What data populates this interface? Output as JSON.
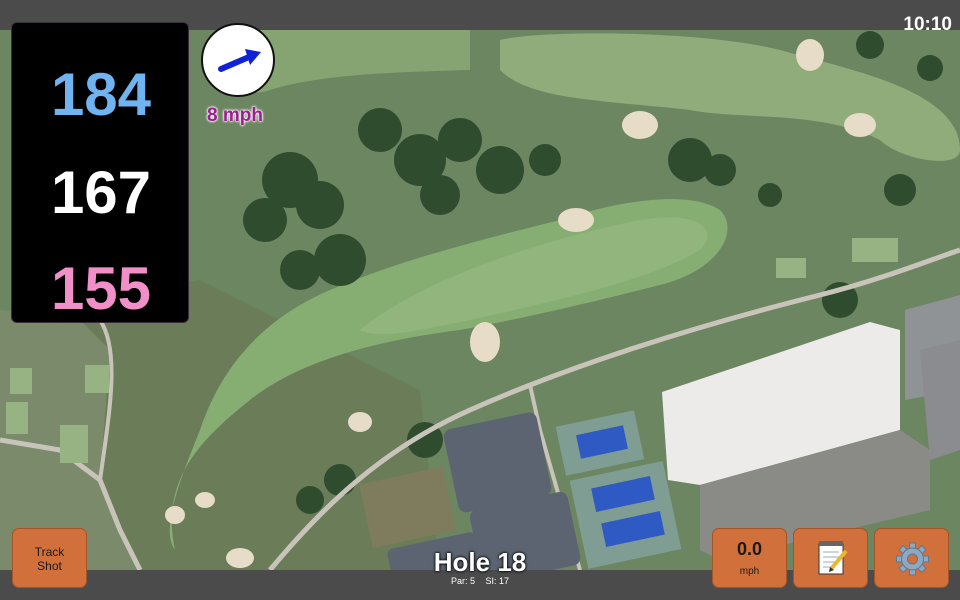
{
  "status": {
    "clock": "10:10"
  },
  "distances": {
    "back": "184",
    "middle": "167",
    "front": "155"
  },
  "wind": {
    "speed_label": "8 mph",
    "direction_icon": "arrow-icon"
  },
  "buttons": {
    "track_line1": "Track",
    "track_line2": "Shot",
    "wind_value": "0.0",
    "wind_unit": "mph",
    "notes_icon": "notepad-icon",
    "settings_icon": "gear-icon"
  },
  "hole": {
    "title": "Hole 18",
    "par": "Par: 5",
    "si": "SI: 17"
  },
  "colors": {
    "back": "#6fb4f0",
    "middle": "#ffffff",
    "front": "#f08fc8",
    "accent": "#d2703c",
    "wind_text": "#9b1f8f"
  }
}
